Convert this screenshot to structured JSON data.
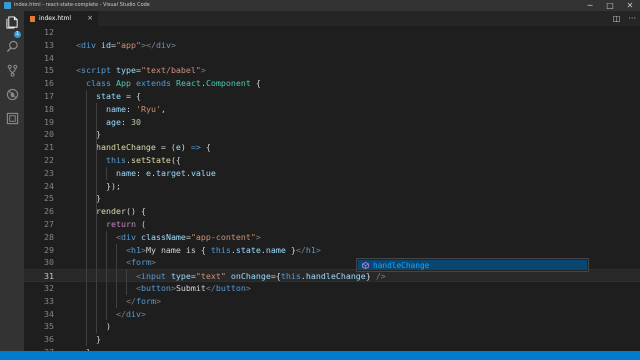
{
  "window": {
    "title": "index.html - react-state-complete - Visual Studio Code",
    "controls": {
      "minimize": "─",
      "maximize": "□",
      "close": "✕"
    }
  },
  "activity_bar": {
    "items": [
      {
        "name": "explorer",
        "icon": "files-icon",
        "badge": "1"
      },
      {
        "name": "search",
        "icon": "search-icon"
      },
      {
        "name": "source-control",
        "icon": "git-branch-icon"
      },
      {
        "name": "debug",
        "icon": "no-bug-icon"
      },
      {
        "name": "extensions",
        "icon": "extensions-icon"
      }
    ]
  },
  "tabs": [
    {
      "label": "index.html",
      "icon": "html-file-icon",
      "close": "×",
      "active": true
    }
  ],
  "tab_actions": {
    "split": "◫",
    "more": "···"
  },
  "editor": {
    "current_line": "31",
    "lines": [
      {
        "num": "12",
        "tokens": []
      },
      {
        "num": "13",
        "tokens": [
          [
            "pun",
            "<"
          ],
          [
            "tag",
            "div"
          ],
          [
            "txt",
            " "
          ],
          [
            "attr",
            "id"
          ],
          [
            "txt",
            "="
          ],
          [
            "str",
            "\"app\""
          ],
          [
            "pun",
            ">"
          ],
          [
            "pun",
            "</"
          ],
          [
            "tag",
            "div"
          ],
          [
            "pun",
            ">"
          ]
        ]
      },
      {
        "num": "14",
        "tokens": []
      },
      {
        "num": "15",
        "tokens": [
          [
            "pun",
            "<"
          ],
          [
            "tag",
            "script"
          ],
          [
            "txt",
            " "
          ],
          [
            "attr",
            "type"
          ],
          [
            "txt",
            "="
          ],
          [
            "str",
            "\"text/babel\""
          ],
          [
            "pun",
            ">"
          ]
        ]
      },
      {
        "num": "16",
        "tokens": [
          [
            "txt",
            "  "
          ],
          [
            "kw",
            "class"
          ],
          [
            "txt",
            " "
          ],
          [
            "cls",
            "App"
          ],
          [
            "txt",
            " "
          ],
          [
            "kw",
            "extends"
          ],
          [
            "txt",
            " "
          ],
          [
            "cls",
            "React"
          ],
          [
            "txt",
            "."
          ],
          [
            "cls",
            "Component"
          ],
          [
            "txt",
            " {"
          ]
        ]
      },
      {
        "num": "17",
        "tokens": [
          [
            "txt",
            "    "
          ],
          [
            "prop",
            "state"
          ],
          [
            "txt",
            " = {"
          ]
        ]
      },
      {
        "num": "18",
        "tokens": [
          [
            "txt",
            "      "
          ],
          [
            "prop",
            "name"
          ],
          [
            "txt",
            ": "
          ],
          [
            "str",
            "'Ryu'"
          ],
          [
            "txt",
            ","
          ]
        ]
      },
      {
        "num": "19",
        "tokens": [
          [
            "txt",
            "      "
          ],
          [
            "prop",
            "age"
          ],
          [
            "txt",
            ": "
          ],
          [
            "num",
            "30"
          ]
        ]
      },
      {
        "num": "20",
        "tokens": [
          [
            "txt",
            "    }"
          ]
        ]
      },
      {
        "num": "21",
        "tokens": [
          [
            "txt",
            "    "
          ],
          [
            "fn",
            "handleChange"
          ],
          [
            "txt",
            " = ("
          ],
          [
            "prop",
            "e"
          ],
          [
            "txt",
            ") "
          ],
          [
            "kw",
            "=>"
          ],
          [
            "txt",
            " {"
          ]
        ]
      },
      {
        "num": "22",
        "tokens": [
          [
            "txt",
            "      "
          ],
          [
            "kw",
            "this"
          ],
          [
            "txt",
            "."
          ],
          [
            "fn",
            "setState"
          ],
          [
            "txt",
            "({"
          ]
        ]
      },
      {
        "num": "23",
        "tokens": [
          [
            "txt",
            "        "
          ],
          [
            "prop",
            "name"
          ],
          [
            "txt",
            ": "
          ],
          [
            "prop",
            "e"
          ],
          [
            "txt",
            "."
          ],
          [
            "prop",
            "target"
          ],
          [
            "txt",
            "."
          ],
          [
            "prop",
            "value"
          ]
        ]
      },
      {
        "num": "24",
        "tokens": [
          [
            "txt",
            "      });"
          ]
        ]
      },
      {
        "num": "25",
        "tokens": [
          [
            "txt",
            "    }"
          ]
        ]
      },
      {
        "num": "26",
        "tokens": [
          [
            "txt",
            "    "
          ],
          [
            "fn",
            "render"
          ],
          [
            "txt",
            "() {"
          ]
        ]
      },
      {
        "num": "27",
        "tokens": [
          [
            "txt",
            "      "
          ],
          [
            "ctl",
            "return"
          ],
          [
            "txt",
            " ("
          ]
        ]
      },
      {
        "num": "28",
        "tokens": [
          [
            "txt",
            "        "
          ],
          [
            "pun",
            "<"
          ],
          [
            "tag",
            "div"
          ],
          [
            "txt",
            " "
          ],
          [
            "attr",
            "className"
          ],
          [
            "txt",
            "="
          ],
          [
            "str",
            "\"app-content\""
          ],
          [
            "pun",
            ">"
          ]
        ]
      },
      {
        "num": "29",
        "tokens": [
          [
            "txt",
            "          "
          ],
          [
            "pun",
            "<"
          ],
          [
            "tag",
            "h1"
          ],
          [
            "pun",
            ">"
          ],
          [
            "txt",
            "My name is { "
          ],
          [
            "kw",
            "this"
          ],
          [
            "txt",
            "."
          ],
          [
            "prop",
            "state"
          ],
          [
            "txt",
            "."
          ],
          [
            "prop",
            "name"
          ],
          [
            "txt",
            " }"
          ],
          [
            "pun",
            "</"
          ],
          [
            "tag",
            "h1"
          ],
          [
            "pun",
            ">"
          ]
        ]
      },
      {
        "num": "30",
        "tokens": [
          [
            "txt",
            "          "
          ],
          [
            "pun",
            "<"
          ],
          [
            "tag",
            "form"
          ],
          [
            "pun",
            ">"
          ]
        ]
      },
      {
        "num": "31",
        "tokens": [
          [
            "txt",
            "            "
          ],
          [
            "pun",
            "<"
          ],
          [
            "tag",
            "input"
          ],
          [
            "txt",
            " "
          ],
          [
            "attr",
            "type"
          ],
          [
            "txt",
            "="
          ],
          [
            "str",
            "\"text\""
          ],
          [
            "txt",
            " "
          ],
          [
            "attr",
            "onChange"
          ],
          [
            "txt",
            "={"
          ],
          [
            "kw",
            "this"
          ],
          [
            "txt",
            "."
          ],
          [
            "prop",
            "handleChange"
          ],
          [
            "txt",
            "} "
          ],
          [
            "pun",
            "/>"
          ]
        ]
      },
      {
        "num": "32",
        "tokens": [
          [
            "txt",
            "            "
          ],
          [
            "pun",
            "<"
          ],
          [
            "tag",
            "button"
          ],
          [
            "pun",
            ">"
          ],
          [
            "txt",
            "Submit"
          ],
          [
            "pun",
            "</"
          ],
          [
            "tag",
            "button"
          ],
          [
            "pun",
            ">"
          ]
        ]
      },
      {
        "num": "33",
        "tokens": [
          [
            "txt",
            "          "
          ],
          [
            "pun",
            "</"
          ],
          [
            "tag",
            "form"
          ],
          [
            "pun",
            ">"
          ]
        ]
      },
      {
        "num": "34",
        "tokens": [
          [
            "txt",
            "        "
          ],
          [
            "pun",
            "</"
          ],
          [
            "tag",
            "div"
          ],
          [
            "pun",
            ">"
          ]
        ]
      },
      {
        "num": "35",
        "tokens": [
          [
            "txt",
            "      )"
          ]
        ]
      },
      {
        "num": "36",
        "tokens": [
          [
            "txt",
            "    }"
          ]
        ]
      },
      {
        "num": "37",
        "tokens": [
          [
            "txt",
            "  }"
          ]
        ]
      }
    ]
  },
  "suggestion": {
    "label": "handleChange",
    "icon": "method-icon"
  },
  "colors": {
    "status_bar": "#007acc",
    "suggestion_highlight": "#094771",
    "suggestion_text": "#18a3ff"
  }
}
